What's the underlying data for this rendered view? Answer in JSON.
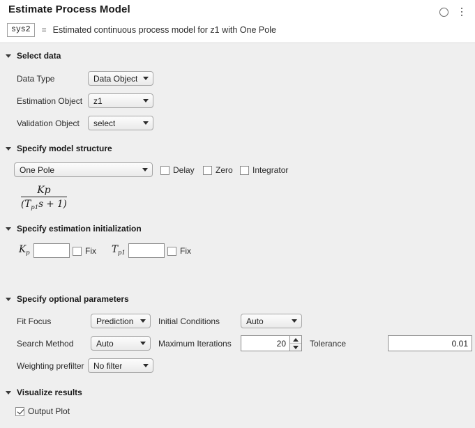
{
  "header": {
    "title": "Estimate Process Model",
    "model_name": "sys2",
    "equals": "=",
    "description": "Estimated continuous process model for z1 with One Pole",
    "status_icon": "circle-progress-icon",
    "menu_icon": "kebab-menu-icon"
  },
  "sections": {
    "select_data": {
      "title": "Select data",
      "expanded": true,
      "rows": [
        {
          "label": "Data Type",
          "value": "Data Object"
        },
        {
          "label": "Estimation Object",
          "value": "z1"
        },
        {
          "label": "Validation Object",
          "value": "select"
        }
      ]
    },
    "model_structure": {
      "title": "Specify model structure",
      "expanded": true,
      "structure": "One Pole",
      "options": [
        {
          "label": "Delay",
          "checked": false
        },
        {
          "label": "Zero",
          "checked": false
        },
        {
          "label": "Integrator",
          "checked": false
        }
      ],
      "formula": {
        "numerator": "Kp",
        "denominator_prefix": "(T",
        "denominator_sub": "p1",
        "denominator_suffix": "s + 1)"
      }
    },
    "estimation_init": {
      "title": "Specify estimation initialization",
      "expanded": true,
      "params": [
        {
          "symbol": "K",
          "symbol_sub": "p",
          "value": "",
          "fix_label": "Fix",
          "fix_checked": false
        },
        {
          "symbol": "T",
          "symbol_sub": "p1",
          "value": "",
          "fix_label": "Fix",
          "fix_checked": false
        }
      ]
    },
    "optional_parameters": {
      "title": "Specify optional parameters",
      "expanded": true,
      "fit_focus": {
        "label": "Fit Focus",
        "value": "Prediction"
      },
      "initial_conditions": {
        "label": "Initial Conditions",
        "value": "Auto"
      },
      "search_method": {
        "label": "Search Method",
        "value": "Auto"
      },
      "maximum_iterations": {
        "label": "Maximum Iterations",
        "value": "20"
      },
      "tolerance": {
        "label": "Tolerance",
        "value": "0.01"
      },
      "weighting_prefilter": {
        "label": "Weighting prefilter",
        "value": "No filter"
      }
    },
    "visualize": {
      "title": "Visualize results",
      "expanded": true,
      "output_plot": {
        "label": "Output Plot",
        "checked": true
      }
    }
  },
  "colors": {
    "background": "#efefef",
    "header_background": "#ffffff",
    "text": "#1a1a1a",
    "border": "#8c8c8c"
  }
}
